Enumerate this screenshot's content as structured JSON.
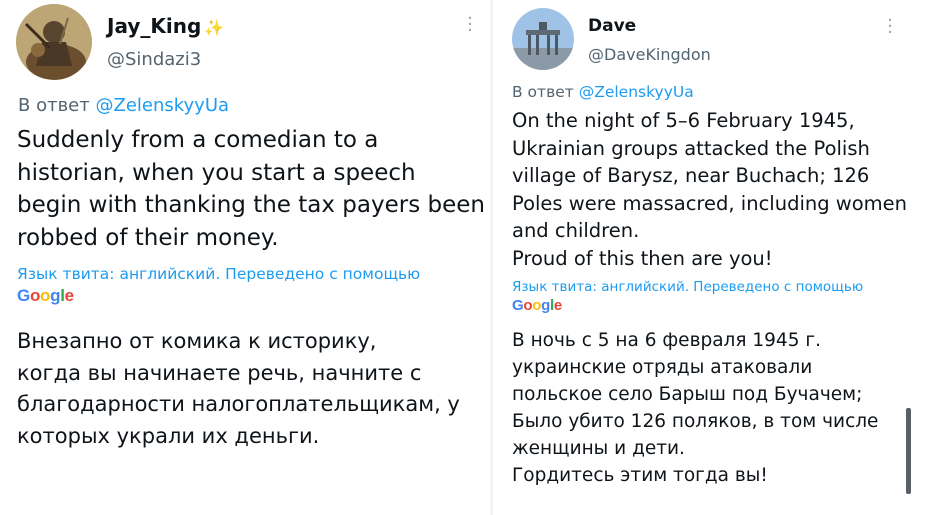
{
  "tweets": [
    {
      "author": {
        "name": "Jay_King",
        "badge": "✨",
        "handle": "@Sindazi3"
      },
      "reply_prefix": "В ответ",
      "reply_to": "@ZelenskyyUa",
      "original_text": "Suddenly from a comedian to a\nhistorian, when you start a speech\nbegin with thanking the tax payers been\nrobbed of their money.",
      "translation_note": "Язык твита: английский. Переведено с помощью",
      "translator": "Google",
      "translated_text": "Внезапно от комика к историку,\nкогда вы начинаете речь, начните с\nблагодарности налогоплательщикам, у\nкоторых украли их деньги."
    },
    {
      "author": {
        "name": "Dave",
        "handle": "@DaveKingdon"
      },
      "reply_prefix": "В ответ",
      "reply_to": "@ZelenskyyUa",
      "original_text": "On the night of 5–6 February 1945,\nUkrainian groups attacked the Polish\nvillage of Barysz, near Buchach; 126\nPoles were massacred, including women\nand children.\nProud of this then are you!",
      "translation_note": "Язык твита: английский. Переведено с помощью",
      "translator": "Google",
      "translated_text": "В ночь с 5 на 6 февраля 1945 г.\nукраинские отряды атаковали\nпольское село Барыш под Бучачем;\nБыло убито 126 поляков, в том числе\nженщины и дети.\nГордитесь этим тогда вы!"
    }
  ],
  "colors": {
    "link": "#1d9bf0",
    "secondary_text": "#536471",
    "google_blue": "#4285F4",
    "google_red": "#EA4335",
    "google_yellow": "#FBBC05",
    "google_green": "#34A853"
  }
}
